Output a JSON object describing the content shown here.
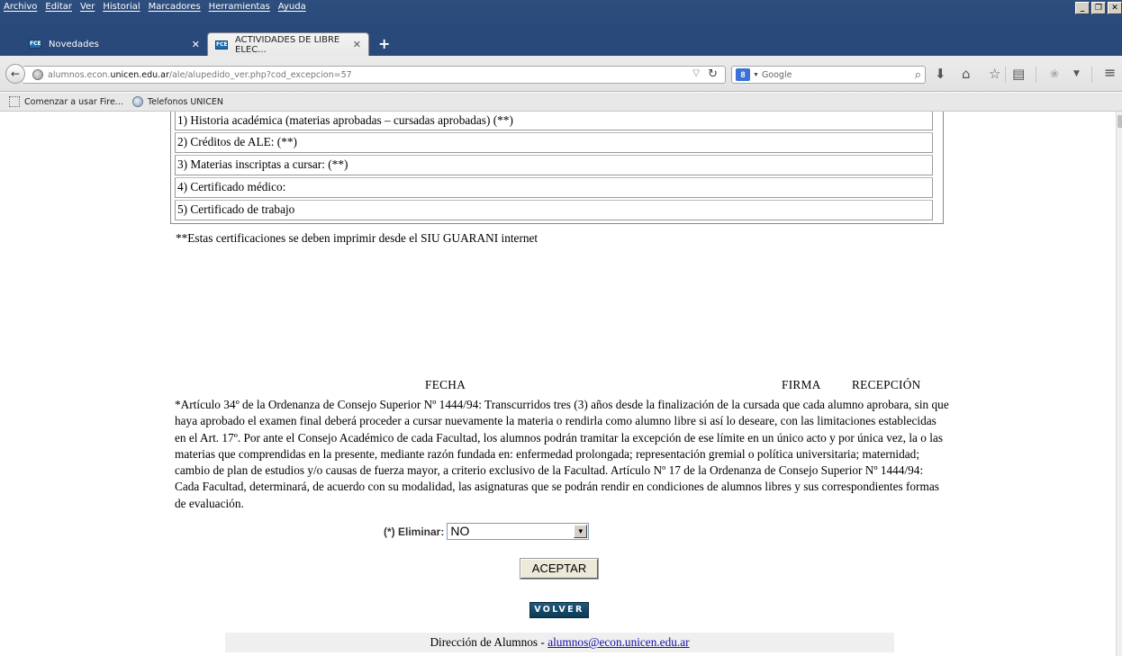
{
  "menubar": {
    "items": [
      "Archivo",
      "Editar",
      "Ver",
      "Historial",
      "Marcadores",
      "Herramientas",
      "Ayuda"
    ]
  },
  "tabs": [
    {
      "label": "Novedades",
      "active": false
    },
    {
      "label": "ACTIVIDADES DE LIBRE ELEC...",
      "active": true
    }
  ],
  "navbar": {
    "url_prefix": "alumnos.econ.",
    "url_domain": "unicen.edu.ar",
    "url_path": "/ale/alupedido_ver.php?cod_excepcion=57",
    "search_placeholder": "Google",
    "search_engine_icon": "8"
  },
  "bookmarks": [
    {
      "label": "Comenzar a usar Fire...",
      "icon": "page-icon"
    },
    {
      "label": "Telefonos UNICEN",
      "icon": "globe-icon"
    }
  ],
  "requirements": [
    "1) Historia académica (materias aprobadas – cursadas aprobadas) (**)",
    "2) Créditos de ALE: (**)",
    "3) Materias inscriptas a cursar: (**)",
    "4) Certificado médico:",
    "5) Certificado de trabajo"
  ],
  "cert_note": "**Estas certificaciones se deben imprimir desde el SIU GUARANI internet",
  "signature": {
    "fecha": "FECHA",
    "firma": "FIRMA",
    "recepcion": "RECEPCIÓN"
  },
  "article_text": "*Artículo 34º de la Ordenanza de Consejo Superior Nº 1444/94: Transcurridos tres (3) años desde la finalización de la cursada que cada alumno aprobara, sin que haya aprobado el examen final deberá proceder a cursar nuevamente la materia o rendirla como alumno libre si así lo deseare, con las limitaciones establecidas en el Art. 17º. Por ante el Consejo Académico de cada Facultad, los alumnos podrán tramitar la excepción de ese límite en un único acto y por única vez, la o las materias que comprendidas en la presente, mediante razón fundada en: enfermedad prolongada; representación gremial o política universitaria; maternidad; cambio de plan de estudios y/o causas de fuerza mayor, a criterio exclusivo de la Facultad. Artículo Nº 17 de la Ordenanza de Consejo Superior Nº 1444/94: Cada Facultad, determinará, de acuerdo con su modalidad, las asignaturas que se podrán rendir en condiciones de alumnos libres y sus correspondientes formas de evaluación.",
  "form": {
    "eliminar_label": "(*) Eliminar:",
    "eliminar_value": "NO",
    "aceptar_label": "ACEPTAR",
    "volver_label": "VOLVER"
  },
  "footer": {
    "text": "Dirección de Alumnos - ",
    "email": "alumnos@econ.unicen.edu.ar"
  }
}
